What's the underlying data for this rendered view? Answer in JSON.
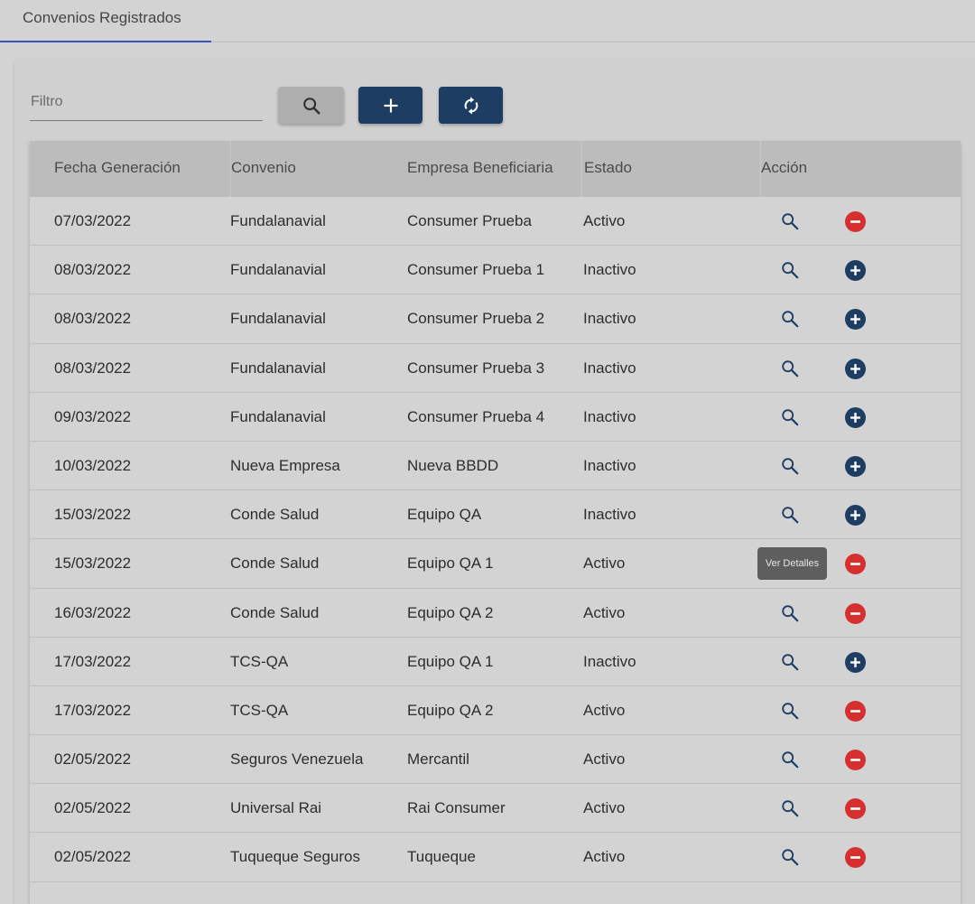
{
  "tab": {
    "label": "Convenios Registrados"
  },
  "filter": {
    "placeholder": "Filtro",
    "value": ""
  },
  "toolbar": {
    "search_icon": "search-icon",
    "add_icon": "plus-icon",
    "refresh_icon": "refresh-icon"
  },
  "table": {
    "headers": {
      "fecha": "Fecha Generación",
      "convenio": "Convenio",
      "empresa": "Empresa Beneficiaria",
      "estado": "Estado",
      "accion": "Acción"
    },
    "rows": [
      {
        "fecha": "07/03/2022",
        "convenio": "Fundalanavial",
        "empresa": "Consumer Prueba",
        "estado": "Activo"
      },
      {
        "fecha": "08/03/2022",
        "convenio": "Fundalanavial",
        "empresa": "Consumer Prueba 1",
        "estado": "Inactivo"
      },
      {
        "fecha": "08/03/2022",
        "convenio": "Fundalanavial",
        "empresa": "Consumer Prueba 2",
        "estado": "Inactivo"
      },
      {
        "fecha": "08/03/2022",
        "convenio": "Fundalanavial",
        "empresa": "Consumer Prueba 3",
        "estado": "Inactivo"
      },
      {
        "fecha": "09/03/2022",
        "convenio": "Fundalanavial",
        "empresa": "Consumer Prueba 4",
        "estado": "Inactivo"
      },
      {
        "fecha": "10/03/2022",
        "convenio": "Nueva Empresa",
        "empresa": "Nueva BBDD",
        "estado": "Inactivo"
      },
      {
        "fecha": "15/03/2022",
        "convenio": "Conde Salud",
        "empresa": "Equipo QA",
        "estado": "Inactivo"
      },
      {
        "fecha": "15/03/2022",
        "convenio": "Conde Salud",
        "empresa": "Equipo QA 1",
        "estado": "Activo"
      },
      {
        "fecha": "16/03/2022",
        "convenio": "Conde Salud",
        "empresa": "Equipo QA 2",
        "estado": "Activo"
      },
      {
        "fecha": "17/03/2022",
        "convenio": "TCS-QA",
        "empresa": "Equipo QA 1",
        "estado": "Inactivo"
      },
      {
        "fecha": "17/03/2022",
        "convenio": "TCS-QA",
        "empresa": "Equipo QA 2",
        "estado": "Activo"
      },
      {
        "fecha": "02/05/2022",
        "convenio": "Seguros Venezuela",
        "empresa": "Mercantil",
        "estado": "Activo"
      },
      {
        "fecha": "02/05/2022",
        "convenio": "Universal Rai",
        "empresa": "Rai Consumer",
        "estado": "Activo"
      },
      {
        "fecha": "02/05/2022",
        "convenio": "Tuqueque Seguros",
        "empresa": "Tuqueque",
        "estado": "Activo"
      }
    ]
  },
  "tooltip": {
    "text": "Ver Detalles"
  },
  "colors": {
    "primary": "#1d3d63",
    "danger": "#d62f2f",
    "tab_indicator": "#3f51b5"
  }
}
